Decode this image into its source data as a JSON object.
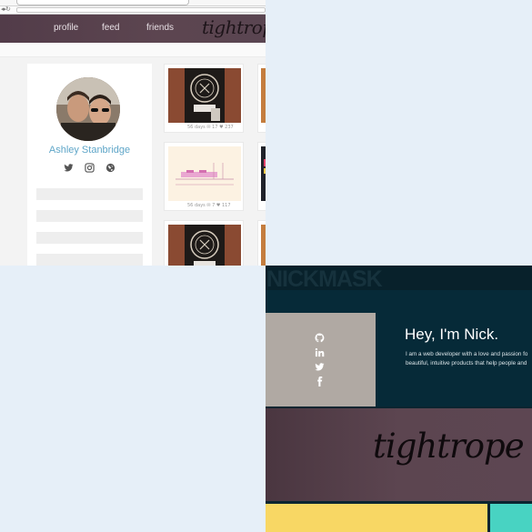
{
  "app": {
    "nav": {
      "links": [
        "profile",
        "feed",
        "friends"
      ],
      "brand": "tightrope"
    },
    "profile": {
      "name": "Ashley Stanbridge",
      "socials": [
        "twitter-icon",
        "instagram-icon",
        "globe-icon"
      ]
    },
    "tiles": [
      {
        "meta": "56 days  ✉ 17  ♥ 237"
      },
      {
        "meta": "56 days  ✉ 7  ♥ 117"
      }
    ]
  },
  "nick": {
    "logo": "NICKMASK",
    "greeting": "Hey, I'm Nick.",
    "bio_line1": "I am a web developer with a love and passion fo",
    "bio_line2": "beautiful, intuitive products that help people and",
    "socials": [
      "github-icon",
      "linkedin-icon",
      "twitter-icon",
      "facebook-icon"
    ],
    "panel_title": "tightrope"
  },
  "colors": {
    "nav_bg": "#5a4551",
    "profile_name": "#5fa6c8",
    "nick_bg": "#062a38",
    "yellow": "#f8d764",
    "teal": "#48d3c2"
  }
}
